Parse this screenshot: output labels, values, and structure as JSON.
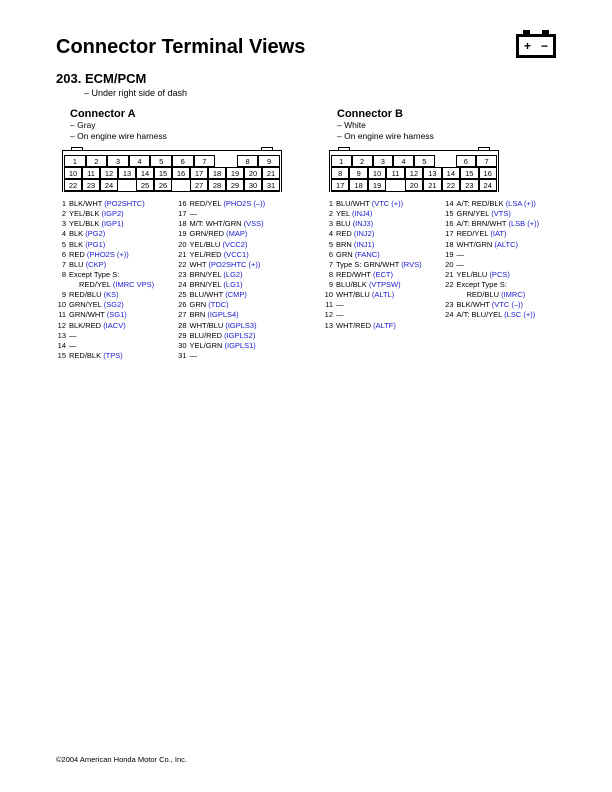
{
  "page_title": "Connector Terminal Views",
  "section_num": "203.",
  "section_name": "ECM/PCM",
  "location_note": "– Under right side of dash",
  "footer": "2004 American Honda Motor Co., Inc.",
  "connectors": [
    {
      "title": "Connector A",
      "color": "– Gray",
      "harness": "– On engine wire harness",
      "rows": [
        [
          "1",
          "2",
          "3",
          "4",
          "5",
          "6",
          "7",
          "",
          "8",
          "9"
        ],
        [
          "10",
          "11",
          "12",
          "13",
          "14",
          "15",
          "16",
          "17",
          "18",
          "19",
          "20",
          "21"
        ],
        [
          "22",
          "23",
          "24",
          "",
          "25",
          "26",
          "",
          "27",
          "28",
          "29",
          "30",
          "31"
        ]
      ],
      "pins_left": [
        {
          "n": "1",
          "c": "BLK/WHT",
          "s": "(PO2SHTC)"
        },
        {
          "n": "2",
          "c": "YEL/BLK",
          "s": "(IGP2)"
        },
        {
          "n": "3",
          "c": "YEL/BLK",
          "s": "(IGP1)"
        },
        {
          "n": "4",
          "c": "BLK",
          "s": "(PG2)"
        },
        {
          "n": "5",
          "c": "BLK",
          "s": "(PG1)"
        },
        {
          "n": "6",
          "c": "RED",
          "s": "(PHO2S (+))"
        },
        {
          "n": "7",
          "c": "BLU",
          "s": "(CKP)"
        },
        {
          "n": "8",
          "c": "Except Type S:",
          "s": ""
        },
        {
          "n": "",
          "c": "RED/YEL",
          "s": "(IMRC VPS)",
          "indent": true
        },
        {
          "n": "9",
          "c": "RED/BLU",
          "s": "(KS)"
        },
        {
          "n": "10",
          "c": "GRN/YEL",
          "s": "(SG2)"
        },
        {
          "n": "11",
          "c": "GRN/WHT",
          "s": "(SG1)"
        },
        {
          "n": "12",
          "c": "BLK/RED",
          "s": "(IACV)"
        },
        {
          "n": "13",
          "c": "—",
          "s": ""
        },
        {
          "n": "14",
          "c": "—",
          "s": ""
        },
        {
          "n": "15",
          "c": "RED/BLK",
          "s": "(TPS)"
        }
      ],
      "pins_right": [
        {
          "n": "16",
          "c": "RED/YEL",
          "s": "(PHO2S (–))"
        },
        {
          "n": "17",
          "c": "—",
          "s": ""
        },
        {
          "n": "18",
          "c": "M/T: WHT/GRN",
          "s": "(VSS)"
        },
        {
          "n": "19",
          "c": "GRN/RED",
          "s": "(MAP)"
        },
        {
          "n": "20",
          "c": "YEL/BLU",
          "s": "(VCC2)"
        },
        {
          "n": "21",
          "c": "YEL/RED",
          "s": "(VCC1)"
        },
        {
          "n": "22",
          "c": "WHT",
          "s": "(PO2SHTC (+))"
        },
        {
          "n": "23",
          "c": "BRN/YEL",
          "s": "(LG2)"
        },
        {
          "n": "24",
          "c": "BRN/YEL",
          "s": "(LG1)"
        },
        {
          "n": "25",
          "c": "BLU/WHT",
          "s": "(CMP)"
        },
        {
          "n": "26",
          "c": "GRN",
          "s": "(TDC)"
        },
        {
          "n": "27",
          "c": "BRN",
          "s": "(IGPLS4)"
        },
        {
          "n": "28",
          "c": "WHT/BLU",
          "s": "(IGPLS3)"
        },
        {
          "n": "29",
          "c": "BLU/RED",
          "s": "(IGPLS2)"
        },
        {
          "n": "30",
          "c": "YEL/GRN",
          "s": "(IGPLS1)"
        },
        {
          "n": "31",
          "c": "—",
          "s": ""
        }
      ]
    },
    {
      "title": "Connector B",
      "color": "– White",
      "harness": "– On engine wire harness",
      "rows": [
        [
          "1",
          "2",
          "3",
          "4",
          "5",
          "",
          "6",
          "7"
        ],
        [
          "8",
          "9",
          "10",
          "11",
          "12",
          "13",
          "14",
          "15",
          "16"
        ],
        [
          "17",
          "18",
          "19",
          "",
          "20",
          "21",
          "22",
          "23",
          "24"
        ]
      ],
      "pins_left": [
        {
          "n": "1",
          "c": "BLU/WHT",
          "s": "(VTC (+))"
        },
        {
          "n": "2",
          "c": "YEL",
          "s": "(INJ4)"
        },
        {
          "n": "3",
          "c": "BLU",
          "s": "(INJ3)"
        },
        {
          "n": "4",
          "c": "RED",
          "s": "(INJ2)"
        },
        {
          "n": "5",
          "c": "BRN",
          "s": "(INJ1)"
        },
        {
          "n": "6",
          "c": "GRN",
          "s": "(FANC)"
        },
        {
          "n": "7",
          "c": "Type S: GRN/WHT",
          "s": "(RVS)"
        },
        {
          "n": "8",
          "c": "RED/WHT",
          "s": "(ECT)"
        },
        {
          "n": "9",
          "c": "BLU/BLK",
          "s": "(VTPSW)"
        },
        {
          "n": "10",
          "c": "WHT/BLU",
          "s": "(ALTL)"
        },
        {
          "n": "11",
          "c": "—",
          "s": ""
        },
        {
          "n": "12",
          "c": "—",
          "s": ""
        },
        {
          "n": "13",
          "c": "WHT/RED",
          "s": "(ALTF)"
        }
      ],
      "pins_right": [
        {
          "n": "14",
          "c": "A/T: RED/BLK",
          "s": "(LSA (+))"
        },
        {
          "n": "15",
          "c": "GRN/YEL",
          "s": "(VTS)"
        },
        {
          "n": "16",
          "c": "A/T: BRN/WHT",
          "s": "(LSB (+))"
        },
        {
          "n": "17",
          "c": "RED/YEL",
          "s": "(IAT)"
        },
        {
          "n": "18",
          "c": "WHT/GRN",
          "s": "(ALTC)"
        },
        {
          "n": "19",
          "c": "—",
          "s": ""
        },
        {
          "n": "20",
          "c": "—",
          "s": ""
        },
        {
          "n": "21",
          "c": "YEL/BLU",
          "s": "(PCS)"
        },
        {
          "n": "22",
          "c": "Except Type S:",
          "s": ""
        },
        {
          "n": "",
          "c": "RED/BLU",
          "s": "(IMRC)",
          "indent": true
        },
        {
          "n": "23",
          "c": "BLK/WHT",
          "s": "(VTC (–))"
        },
        {
          "n": "24",
          "c": "A/T: BLU/YEL",
          "s": "(LSC (+))"
        }
      ]
    }
  ]
}
